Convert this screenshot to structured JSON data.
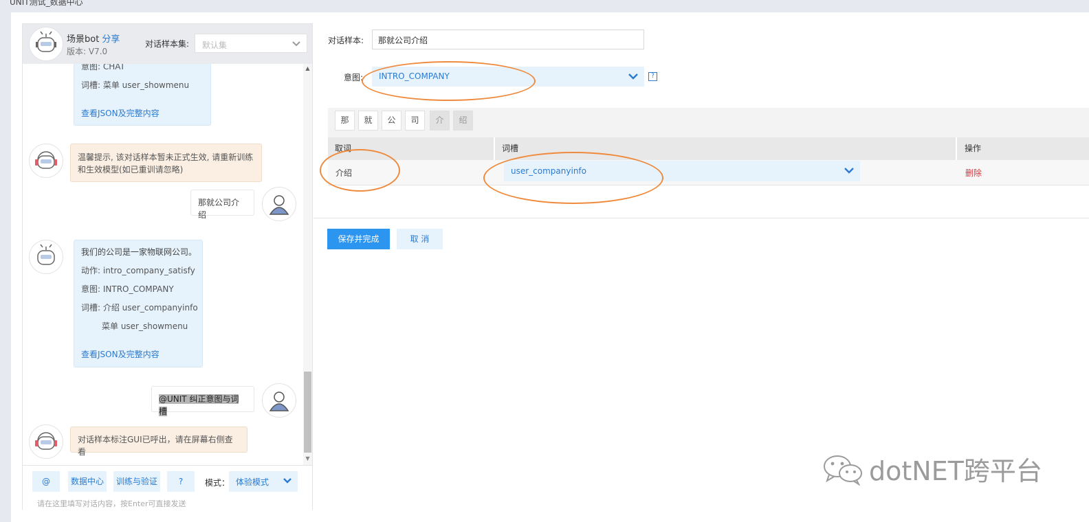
{
  "window": {
    "title": "UNIT测试_数据中心"
  },
  "bot": {
    "name": "场景bot",
    "share": "分享",
    "version": "版本: V7.0"
  },
  "sample_set": {
    "label": "对话样本集:",
    "value": "默认集"
  },
  "chat": {
    "msg1": {
      "intent": "意图: CHAT",
      "slot": "词槽: 菜单 user_showmenu",
      "link": "查看JSON及完整内容"
    },
    "warn1": {
      "line1": "温馨提示, 该对话样本暂未正式生效, 请重新训练",
      "line2": "和生效模型(如已重训请忽略)"
    },
    "user1": "那就公司介绍",
    "msg2": {
      "reply": "我们的公司是一家物联网公司。",
      "action": "动作: intro_company_satisfy",
      "intent": "意图: INTRO_COMPANY",
      "slot1": "词槽: 介绍 user_companyinfo",
      "slot2": "菜单 user_showmenu",
      "link": "查看JSON及完整内容"
    },
    "user2": "@UNIT 纠正意图与词槽",
    "warn2": "对话样本标注GUI已呼出，请在屏幕右侧查看"
  },
  "footer": {
    "at": "@",
    "data_center": "数据中心",
    "train": "训练与验证",
    "help": "?",
    "mode_label": "模式：",
    "mode_value": "体验模式",
    "placeholder": "请在这里填写对话内容，按Enter可直接发送"
  },
  "editor": {
    "sample_label": "对话样本:",
    "sample_value": "那就公司介绍",
    "intent_label": "意图:",
    "intent_value": "INTRO_COMPANY",
    "help": "?",
    "chars": [
      "那",
      "就",
      "公",
      "司",
      "介",
      "绍"
    ],
    "columns": {
      "word": "取词",
      "slot": "词槽",
      "action": "操作"
    },
    "row": {
      "word": "介绍",
      "slot": "user_companyinfo",
      "action": "删除"
    },
    "save": "保存并完成",
    "cancel": "取 消"
  },
  "watermark": "dotNET跨平台",
  "colors": {
    "accent": "#2b95f0",
    "link": "#2a7ad0",
    "annotation": "#ef8a3c",
    "delete": "#d9363e"
  }
}
